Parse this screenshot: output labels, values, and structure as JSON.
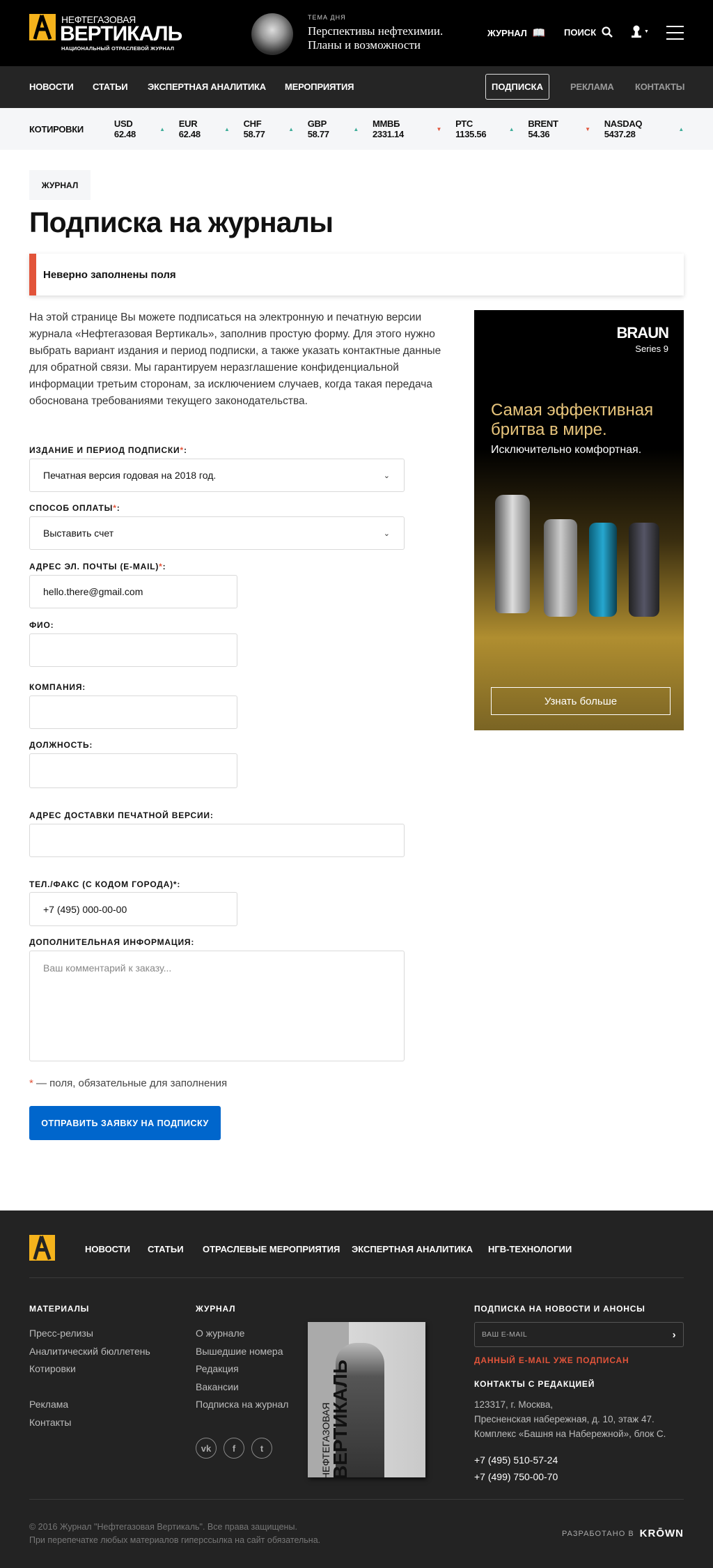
{
  "header": {
    "logo_top": "НЕФТЕГАЗОВАЯ",
    "logo_main": "ВЕРТИКАЛЬ",
    "logo_sub": "НАЦИОНАЛЬНЫЙ ОТРАСЛЕВОЙ ЖУРНАЛ",
    "topic_label": "ТЕМА ДНЯ",
    "topic_line1": "Перспективы нефтехимии.",
    "topic_line2": "Планы и возможности",
    "journal": "ЖУРНАЛ",
    "search": "ПОИСК"
  },
  "nav": {
    "items": [
      "НОВОСТИ",
      "СТАТЬИ",
      "ЭКСПЕРТНАЯ АНАЛИТИКА",
      "МЕРОПРИЯТИЯ"
    ],
    "subscribe": "ПОДПИСКА",
    "ads": "РЕКЛАМА",
    "contacts": "КОНТАКТЫ"
  },
  "quotes": {
    "label": "КОТИРОВКИ",
    "items": [
      {
        "t": "USD 62.48",
        "dir": "up"
      },
      {
        "t": "EUR 62.48",
        "dir": "up"
      },
      {
        "t": "CHF 58.77",
        "dir": "up"
      },
      {
        "t": "GBP 58.77",
        "dir": "up"
      },
      {
        "t": "ММВБ 2331.14",
        "dir": "down"
      },
      {
        "t": "РТС 1135.56",
        "dir": "up"
      },
      {
        "t": "BRENT 54.36",
        "dir": "down"
      },
      {
        "t": "NASDAQ 5437.28",
        "dir": "up"
      }
    ]
  },
  "page": {
    "breadcrumb": "ЖУРНАЛ",
    "title": "Подписка на журналы",
    "error": "Неверно заполнены поля",
    "intro": "На этой странице Вы можете подписаться на электронную и печатную версии журнала «Нефтегазовая Вертикаль», заполнив простую форму. Для этого нужно выбрать вариант издания и период подписки, а также указать контактные данные для обратной связи. Мы гарантируем неразглашение конфиденциальной информации третьим сторонам, за исключением случаев, когда такая передача обоснована требованиями текущего законодательства."
  },
  "form": {
    "edition_label": "ИЗДАНИЕ И ПЕРИОД ПОДПИСКИ",
    "edition_value": "Печатная версия годовая на 2018 год.",
    "payment_label": "СПОСОБ ОПЛАТЫ",
    "payment_value": "Выставить счет",
    "email_label": "АДРЕС ЭЛ. ПОЧТЫ (E-MAIL)",
    "email_value": "hello.there@gmail.com",
    "name_label": "ФИО:",
    "company_label": "КОМПАНИЯ:",
    "position_label": "ДОЛЖНОСТЬ:",
    "address_label": "АДРЕС ДОСТАВКИ ПЕЧАТНОЙ ВЕРСИИ:",
    "phone_label": "ТЕЛ./ФАКС (С КОДОМ ГОРОДА)*:",
    "phone_value": "+7 (495) 000-00-00",
    "info_label": "ДОПОЛНИТЕЛЬНАЯ ИНФОРМАЦИЯ:",
    "info_placeholder": "Ваш комментарий к заказу...",
    "req_star": "*",
    "colon": ":",
    "req_note": " — поля, обязательные для заполнения",
    "submit": "ОТПРАВИТЬ ЗАЯВКУ НА ПОДПИСКУ"
  },
  "ad": {
    "brand": "BRAUN",
    "series": "Series 9",
    "headline1": "Самая эффективная",
    "headline2": "бритва в мире.",
    "sub": "Исключительно комфортная.",
    "cta": "Узнать больше"
  },
  "footer": {
    "nav": [
      "НОВОСТИ",
      "СТАТЬИ",
      "ОТРАСЛЕВЫЕ МЕРОПРИЯТИЯ",
      "ЭКСПЕРТНАЯ АНАЛИТИКА",
      "НГВ-ТЕХНОЛОГИИ"
    ],
    "materials_title": "МАТЕРИАЛЫ",
    "materials": [
      "Пресс-релизы",
      "Аналитический бюллетень",
      "Котировки",
      "Реклама",
      "Контакты"
    ],
    "journal_title": "ЖУРНАЛ",
    "journal": [
      "О журнале",
      "Вышедшие номера",
      "Редакция",
      "Вакансии",
      "Подписка на журнал"
    ],
    "cover_title1": "НЕФТЕГАЗОВАЯ",
    "cover_title2": "ВЕРТИКАЛЬ",
    "subscribe_title": "ПОДПИСКА НА НОВОСТИ И АНОНСЫ",
    "email_placeholder": "ВАШ E-MAIL",
    "subscribe_error": "ДАННЫЙ E-MAIL УЖЕ ПОДПИСАН",
    "contacts_title": "КОНТАКТЫ С РЕДАКЦИЕЙ",
    "address": [
      "123317, г. Москва,",
      "Пресненская набережная, д. 10, этаж 47.",
      "Комплекс «Башня на Набережной», блок C."
    ],
    "phones": [
      "+7 (495) 510-57-24",
      "+7 (499) 750-00-70"
    ],
    "copyright1": "© 2016 Журнал \"Нефтегазовая Вертикаль\". Все права защищены.",
    "copyright2": "При перепечатке любых материалов гиперссылка на сайт обязательна.",
    "dev": "РАЗРАБОТАНО В",
    "dev_brand": "KRŌWN"
  },
  "colors": {
    "accent": "#f5b31c",
    "error": "#e2543a",
    "button": "#0066cc",
    "up": "#3fae9a",
    "down": "#e2543a"
  }
}
